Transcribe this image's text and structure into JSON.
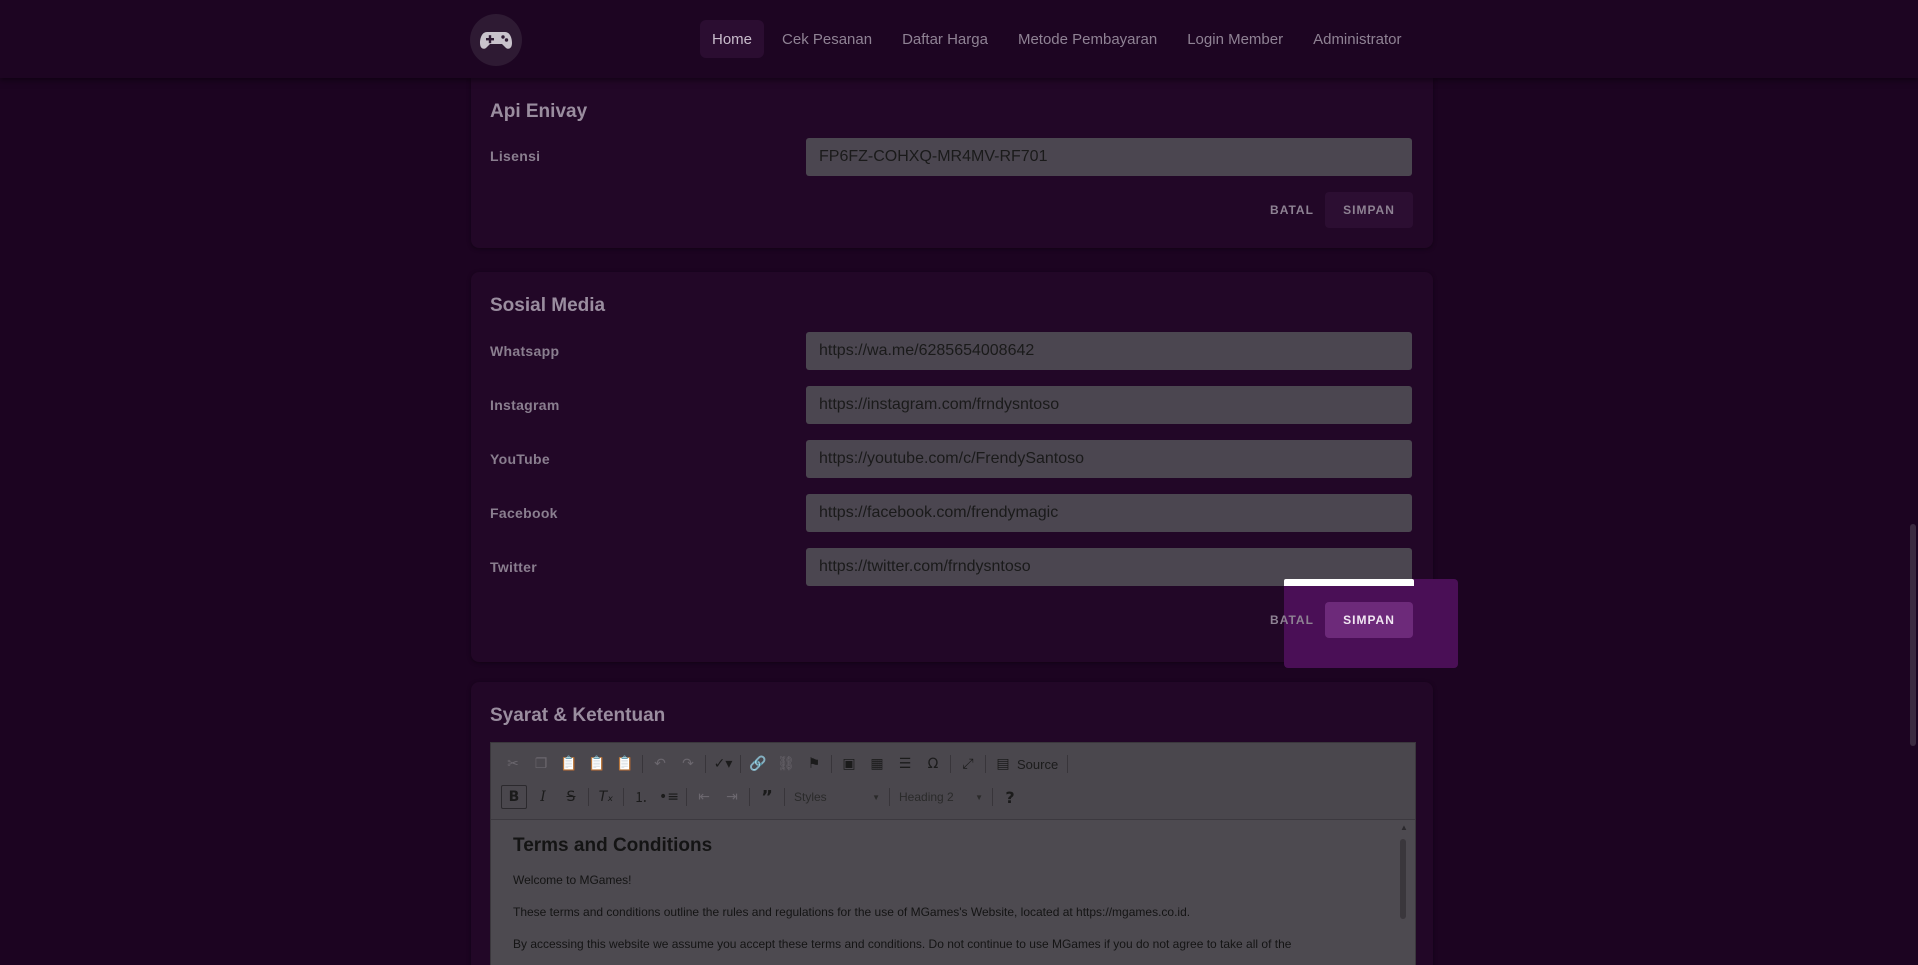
{
  "nav": {
    "logo_icon": "gamepad-icon",
    "items": [
      {
        "label": "Home",
        "active": true
      },
      {
        "label": "Cek Pesanan",
        "active": false
      },
      {
        "label": "Daftar Harga",
        "active": false
      },
      {
        "label": "Metode Pembayaran",
        "active": false
      },
      {
        "label": "Login Member",
        "active": false
      },
      {
        "label": "Administrator",
        "active": false
      }
    ]
  },
  "api": {
    "title": "Api Enivay",
    "license_label": "Lisensi",
    "license_value": "FP6FZ-COHXQ-MR4MV-RF701",
    "cancel_label": "BATAL",
    "save_label": "SIMPAN"
  },
  "social": {
    "title": "Sosial Media",
    "fields": [
      {
        "label": "Whatsapp",
        "value": "https://wa.me/6285654008642"
      },
      {
        "label": "Instagram",
        "value": "https://instagram.com/frndysntoso"
      },
      {
        "label": "YouTube",
        "value": "https://youtube.com/c/FrendySantoso"
      },
      {
        "label": "Facebook",
        "value": "https://facebook.com/frendymagic"
      },
      {
        "label": "Twitter",
        "value": "https://twitter.com/frndysntoso"
      }
    ],
    "cancel_label": "BATAL",
    "save_label": "SIMPAN"
  },
  "terms": {
    "title": "Syarat & Ketentuan",
    "toolbar": {
      "source_label": "Source",
      "styles_label": "Styles",
      "format_label": "Heading 2",
      "help_label": "?"
    },
    "heading": "Terms and Conditions",
    "paragraphs": [
      "Welcome to MGames!",
      "These terms and conditions outline the rules and regulations for the use of MGames's Website, located at https://mgames.co.id.",
      "By accessing this website we assume you accept these terms and conditions. Do not continue to use MGames if you do not agree to take all of the"
    ]
  },
  "colors": {
    "background": "#1c0421",
    "accent": "#6d2a7a"
  }
}
